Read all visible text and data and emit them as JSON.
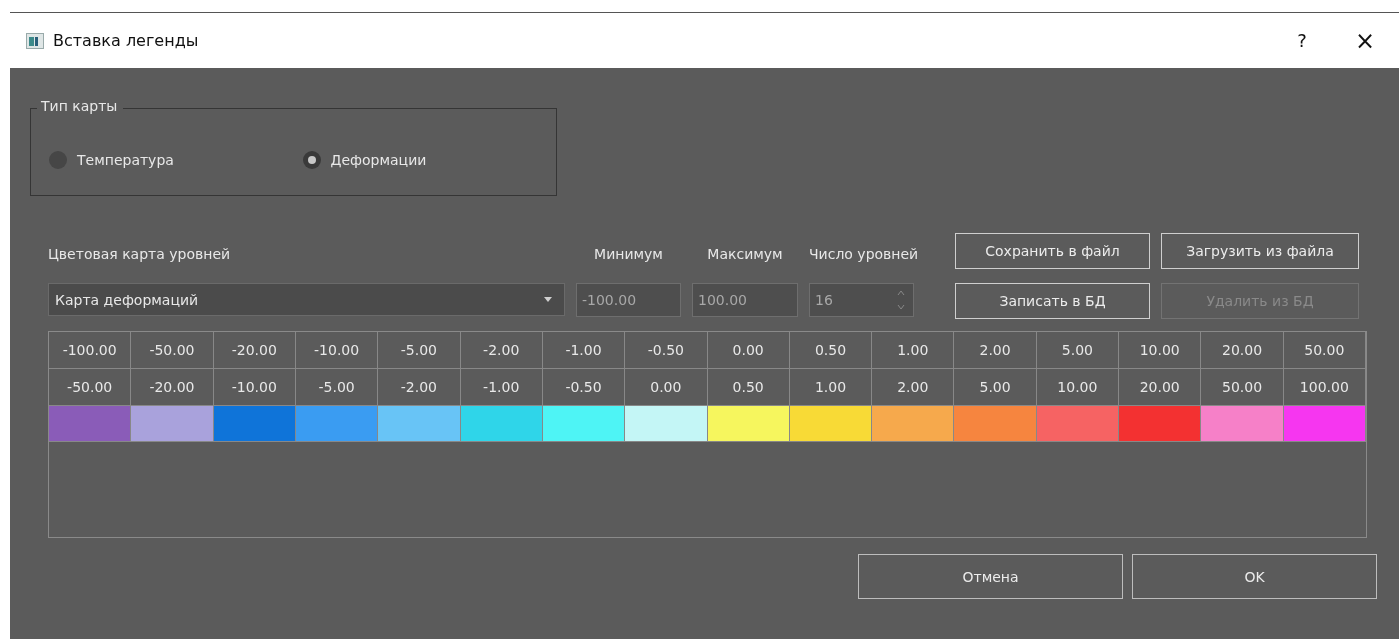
{
  "window": {
    "title": "Вставка легенды",
    "help": "?",
    "close": "×"
  },
  "map_type": {
    "title": "Тип карты",
    "options": [
      {
        "label": "Температура",
        "selected": false
      },
      {
        "label": "Деформации",
        "selected": true
      }
    ]
  },
  "colormap": {
    "label": "Цветовая карта уровней",
    "value": "Карта деформаций"
  },
  "minimum": {
    "label": "Минимум",
    "value": "-100.00",
    "disabled": true
  },
  "maximum": {
    "label": "Максимум",
    "value": "100.00",
    "disabled": true
  },
  "levels": {
    "label": "Число уровней",
    "value": "16",
    "disabled": true
  },
  "actions": [
    {
      "label": "Сохранить в файл",
      "disabled": false
    },
    {
      "label": "Загрузить из файла",
      "disabled": false
    },
    {
      "label": "Записать в БД",
      "disabled": false
    },
    {
      "label": "Удалить из БД",
      "disabled": true
    }
  ],
  "table": {
    "columns": [
      {
        "from": "-100.00",
        "to": "-50.00",
        "color": "#8a5cb8"
      },
      {
        "from": "-50.00",
        "to": "-20.00",
        "color": "#a9a2dc"
      },
      {
        "from": "-20.00",
        "to": "-10.00",
        "color": "#0f74d9"
      },
      {
        "from": "-10.00",
        "to": "-5.00",
        "color": "#3a9cf2"
      },
      {
        "from": "-5.00",
        "to": "-2.00",
        "color": "#68c4f6"
      },
      {
        "from": "-2.00",
        "to": "-1.00",
        "color": "#2fd5e9"
      },
      {
        "from": "-1.00",
        "to": "-0.50",
        "color": "#4ef4f5"
      },
      {
        "from": "-0.50",
        "to": "0.00",
        "color": "#c4f6f6"
      },
      {
        "from": "0.00",
        "to": "0.50",
        "color": "#f6f65e"
      },
      {
        "from": "0.50",
        "to": "1.00",
        "color": "#f8da36"
      },
      {
        "from": "1.00",
        "to": "2.00",
        "color": "#f6a94c"
      },
      {
        "from": "2.00",
        "to": "5.00",
        "color": "#f6853f"
      },
      {
        "from": "5.00",
        "to": "10.00",
        "color": "#f66363"
      },
      {
        "from": "10.00",
        "to": "20.00",
        "color": "#f33131"
      },
      {
        "from": "20.00",
        "to": "50.00",
        "color": "#f680c8"
      },
      {
        "from": "50.00",
        "to": "100.00",
        "color": "#f636f0"
      }
    ]
  },
  "buttons": [
    {
      "label": "Отмена"
    },
    {
      "label": "OK"
    }
  ]
}
